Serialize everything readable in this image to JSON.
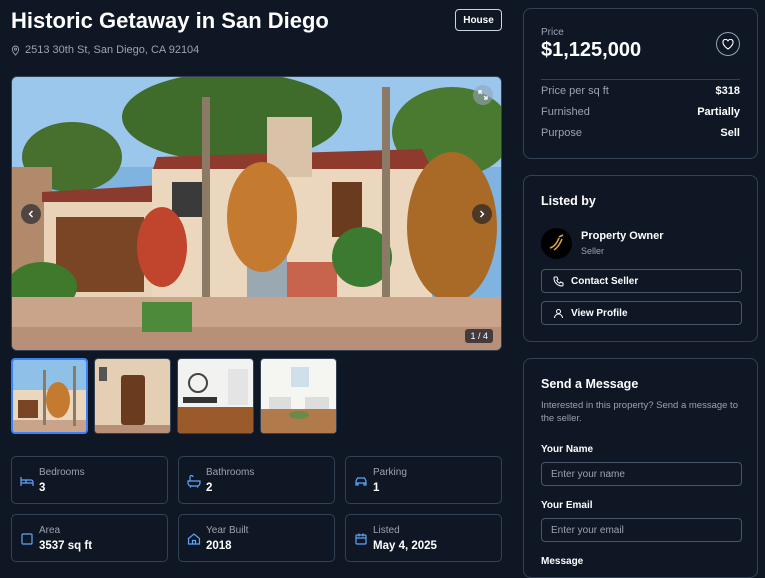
{
  "listing": {
    "title": "Historic Getaway in San Diego",
    "type_badge": "House",
    "address": "2513 30th St, San Diego, CA 92104",
    "gallery": {
      "counter": "1 / 4"
    }
  },
  "stats": [
    {
      "label": "Bedrooms",
      "value": "3",
      "icon": "bed-icon"
    },
    {
      "label": "Bathrooms",
      "value": "2",
      "icon": "bath-icon"
    },
    {
      "label": "Parking",
      "value": "1",
      "icon": "car-icon"
    },
    {
      "label": "Area",
      "value": "3537 sq ft",
      "icon": "square-icon"
    },
    {
      "label": "Year Built",
      "value": "2018",
      "icon": "home-icon"
    },
    {
      "label": "Listed",
      "value": "May 4, 2025",
      "icon": "calendar-icon"
    }
  ],
  "price_card": {
    "label": "Price",
    "price": "$1,125,000",
    "rows": [
      {
        "key": "Price per sq ft",
        "value": "$318"
      },
      {
        "key": "Furnished",
        "value": "Partially"
      },
      {
        "key": "Purpose",
        "value": "Sell"
      }
    ]
  },
  "listed_by": {
    "heading": "Listed by",
    "name": "Property Owner",
    "role": "Seller",
    "contact_label": "Contact Seller",
    "profile_label": "View Profile"
  },
  "message": {
    "heading": "Send a Message",
    "subtitle": "Interested in this property? Send a message to the seller.",
    "name_label": "Your Name",
    "name_placeholder": "Enter your name",
    "email_label": "Your Email",
    "email_placeholder": "Enter your email",
    "message_label": "Message"
  },
  "colors": {
    "background": "#0f1724",
    "accent": "#60a5fa",
    "border": "#334155"
  }
}
